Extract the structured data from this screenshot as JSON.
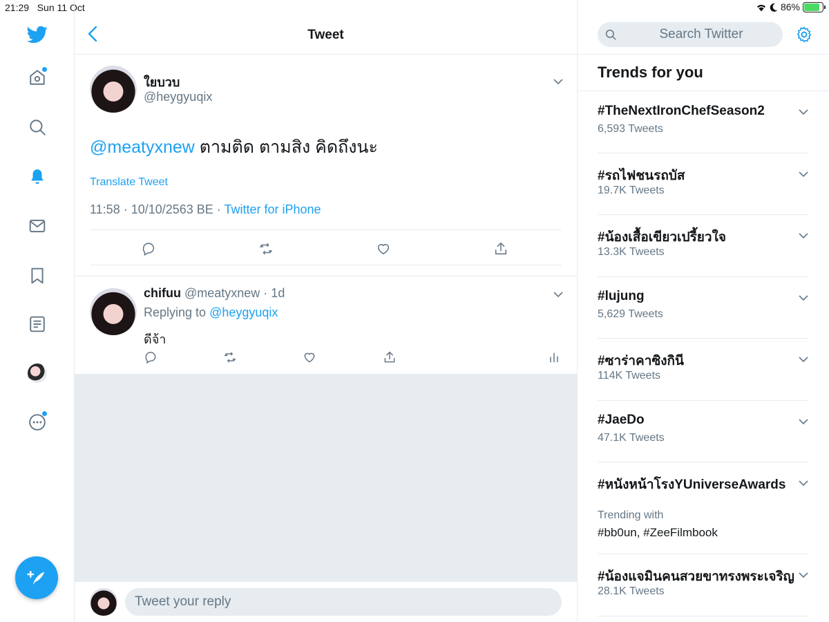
{
  "status_bar": {
    "time": "21:29",
    "date": "Sun 11 Oct",
    "battery": "86%"
  },
  "nav": {
    "items": [
      "twitter-logo",
      "home",
      "explore",
      "notifications",
      "messages",
      "bookmarks",
      "lists",
      "profile",
      "more"
    ],
    "accent": "#1da1f2"
  },
  "header": {
    "title": "Tweet"
  },
  "tweet": {
    "author_name": "ใยบวบ",
    "author_handle": "@heygyuqix",
    "mention": "@meatyxnew",
    "text": " ตามติด ตามสิง คิดถึงนะ",
    "translate": "Translate Tweet",
    "meta_time": "11:58 · 10/10/2563 BE · ",
    "meta_source": "Twitter for iPhone"
  },
  "reply": {
    "name": "chifuu",
    "handle_time": " @meatyxnew · 1d",
    "replying_prefix": "Replying to ",
    "replying_to": "@heygyuqix",
    "text": "ดีจ้า"
  },
  "reply_bar": {
    "placeholder": "Tweet your reply"
  },
  "search": {
    "placeholder": "Search Twitter"
  },
  "trends": {
    "title": "Trends for you",
    "items": [
      {
        "name": "#TheNextIronChefSeason2",
        "count": "6,593 Tweets"
      },
      {
        "name": "#รถไฟชนรถบัส",
        "count": "19.7K Tweets"
      },
      {
        "name": "#น้องเสื้อเขียวเปรี้ยวใจ",
        "count": "13.3K Tweets"
      },
      {
        "name": "#lujung",
        "count": "5,629 Tweets"
      },
      {
        "name": "#ซาร่าคาซิงกินี",
        "count": "114K Tweets"
      },
      {
        "name": "#JaeDo",
        "count": "47.1K Tweets"
      },
      {
        "name": "#หนังหน้าโรงYUniverseAwards",
        "with_label": "Trending with",
        "with_tags": "#bb0un, #ZeeFilmbook"
      },
      {
        "name": "#น้องแจมินคนสวยขาทรงพระเจริญ",
        "count": "28.1K Tweets"
      }
    ]
  }
}
